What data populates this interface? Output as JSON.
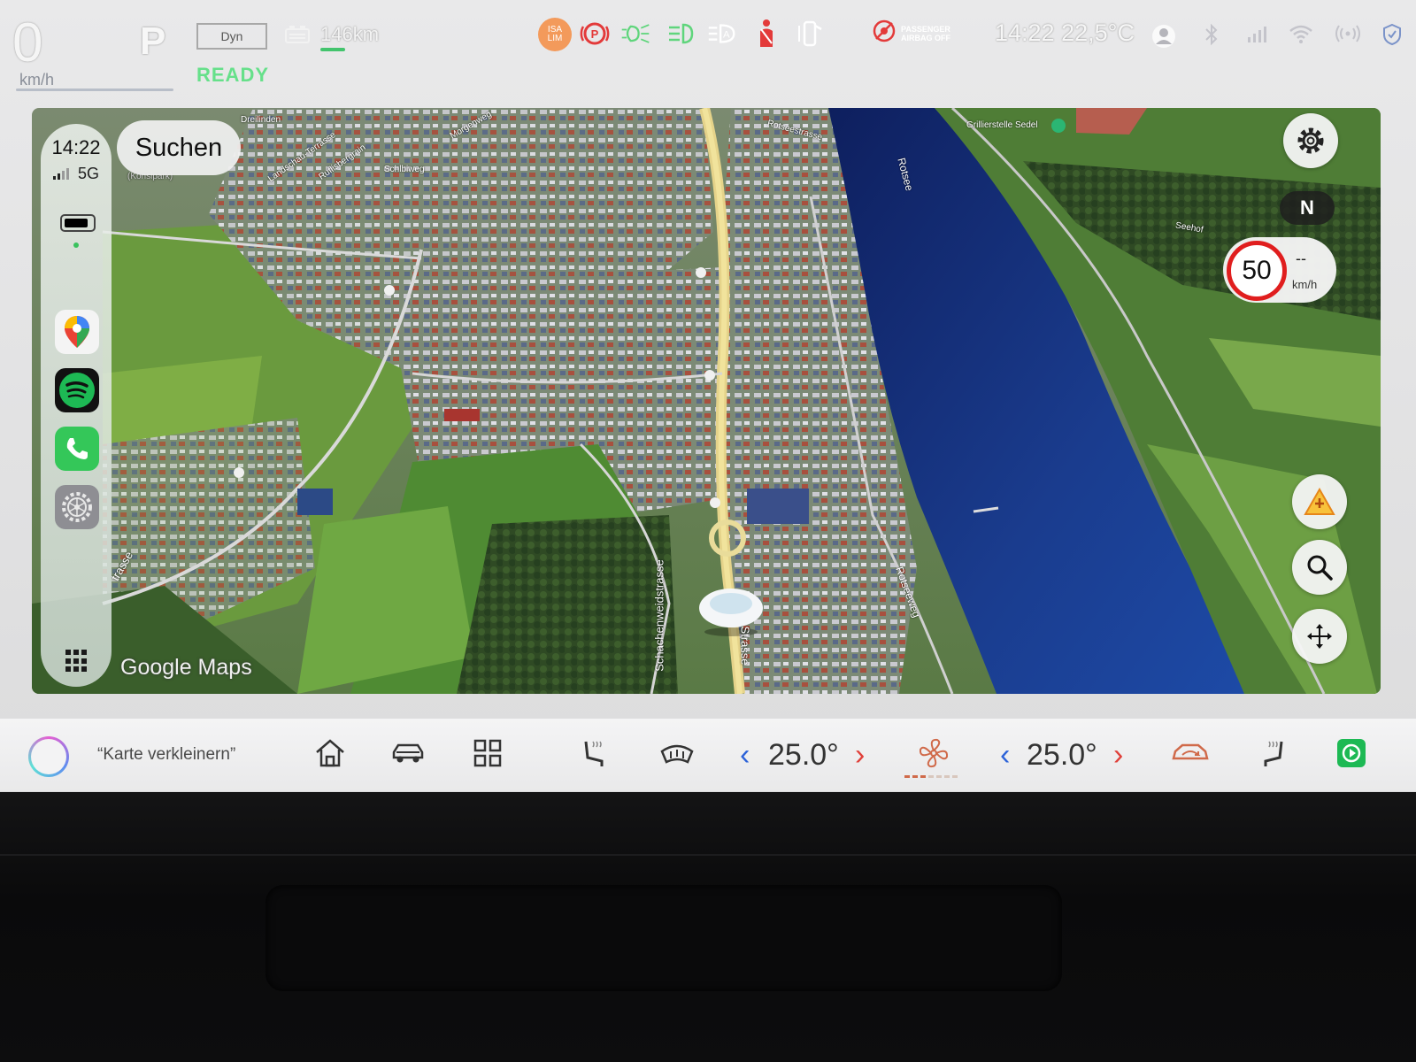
{
  "status": {
    "speed": "0",
    "speed_unit": "km/h",
    "gear": "P",
    "drive_mode": "Dyn",
    "ready": "READY",
    "range": "146km",
    "isa_label": "ISA\nLIM",
    "passenger_airbag": "PASSENGER AIRBAG OFF",
    "clock": "14:22",
    "temperature": "22,5°C"
  },
  "carplay": {
    "time": "14:22",
    "network": "5G",
    "search_label": "Suchen",
    "apps": [
      "google-maps",
      "spotify",
      "phone",
      "settings"
    ]
  },
  "map": {
    "attribution": "Google Maps",
    "compass": "N",
    "speed_limit": "50",
    "current_speed": "--",
    "current_speed_unit": "km/h",
    "labels": [
      "Dreilinden",
      "Morgenweg",
      "Rotseestrasse",
      "Grillierstelle Sedel",
      "Rotsee",
      "Landschau-Terrasse",
      "Ruflisbergrain",
      "Schlbiweg",
      "(Konsipark)",
      "Seehof",
      "Rotseeweg",
      "Schachenweidstrasse",
      "Strasse",
      "trasse"
    ]
  },
  "bottombar": {
    "voice_hint": "“Karte verkleinern”",
    "left_temp": "25.0°",
    "right_temp": "25.0°",
    "fan_level": 3,
    "fan_max": 7
  },
  "colors": {
    "ready_green": "#66e08a",
    "limit_red": "#e01e1e",
    "temp_down_blue": "#2c62d8",
    "temp_up_red": "#e0403a",
    "fan_orange": "#d06a4a",
    "carplay_green": "#1db954"
  },
  "icons": {
    "status_telltales": [
      "isa-lim-icon",
      "parking-brake-icon",
      "low-beam-icon",
      "position-light-icon",
      "auto-high-beam-icon",
      "seatbelt-warning-icon",
      "door-open-icon",
      "passenger-airbag-off-icon"
    ],
    "system_icons": [
      "user-icon",
      "bluetooth-icon",
      "cellular-icon",
      "wifi-icon",
      "hotspot-icon",
      "shield-icon"
    ],
    "bottom_icons": [
      "home-icon",
      "car-icon",
      "apps-grid-icon",
      "seat-heat-left-icon",
      "defrost-icon",
      "fan-icon",
      "recirculation-icon",
      "seat-heat-right-icon",
      "carplay-icon"
    ]
  }
}
